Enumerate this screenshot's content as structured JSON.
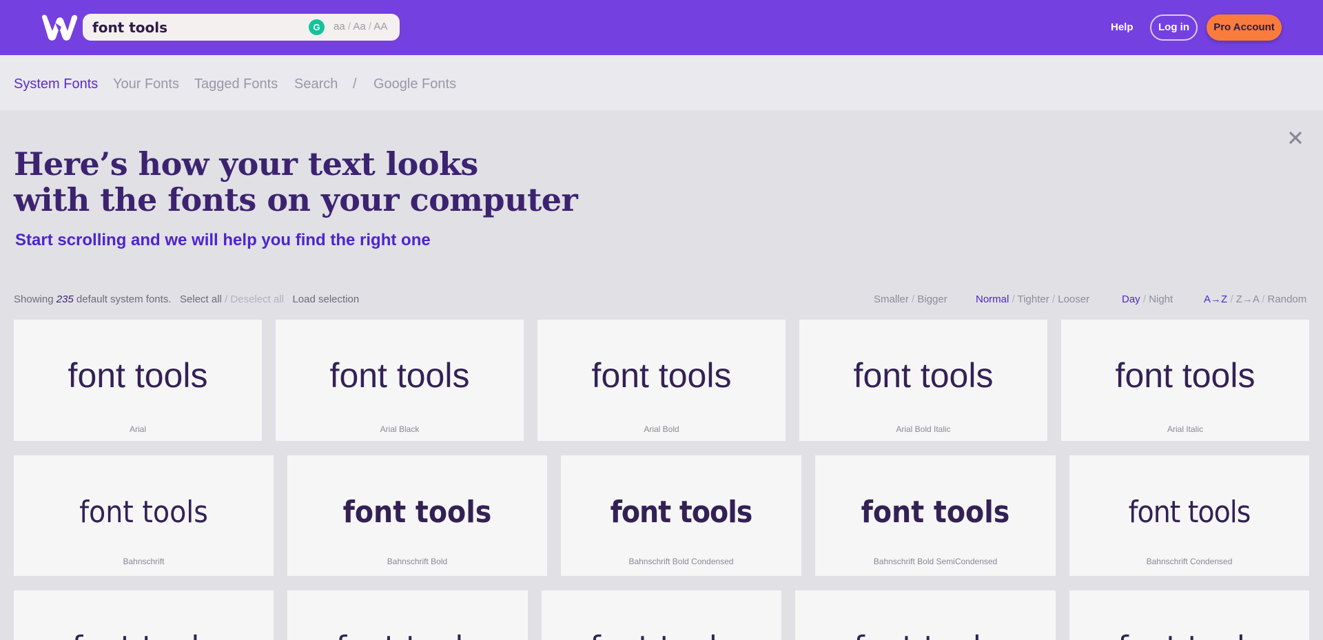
{
  "header": {
    "logo_icon": "fonts-w-logo-icon",
    "search_value": "font tools",
    "grammarly_icon": "grammarly-icon",
    "grammarly_glyph": "G",
    "case_options": [
      "aa",
      "Aa",
      "AA"
    ],
    "case_separator": "/",
    "help_label": "Help",
    "login_label": "Log in",
    "pro_label": "Pro Account"
  },
  "nav": {
    "system_fonts": "System Fonts",
    "your_fonts": "Your Fonts",
    "tagged_fonts": "Tagged Fonts",
    "search": "Search",
    "divider": "/",
    "google_fonts": "Google Fonts"
  },
  "hero": {
    "title_line1": "Here’s how your text looks",
    "title_line2": "with the fonts on your computer",
    "subtitle": "Start scrolling and we will help you find the right one",
    "close_icon": "close-icon"
  },
  "controls": {
    "showing_prefix": "Showing",
    "count": "235",
    "showing_suffix": "default system fonts.",
    "select_all": "Select all",
    "separator": "/",
    "deselect_all": "Deselect all",
    "load_selection": "Load selection",
    "size": {
      "smaller": "Smaller",
      "bigger": "Bigger"
    },
    "spacing": {
      "normal": "Normal",
      "tighter": "Tighter",
      "looser": "Looser",
      "selected": "Normal"
    },
    "theme": {
      "day": "Day",
      "night": "Night",
      "selected": "Day"
    },
    "sort": {
      "az": "A→Z",
      "za": "Z→A",
      "random": "Random",
      "selected": "A→Z"
    }
  },
  "sample_text": "font tools",
  "cards": {
    "row1": [
      {
        "name": "Arial"
      },
      {
        "name": "Arial Black"
      },
      {
        "name": "Arial Bold"
      },
      {
        "name": "Arial Bold Italic"
      },
      {
        "name": "Arial Italic"
      }
    ],
    "row2": [
      {
        "name": "Bahnschrift"
      },
      {
        "name": "Bahnschrift Bold"
      },
      {
        "name": "Bahnschrift Bold Condensed"
      },
      {
        "name": "Bahnschrift Bold SemiCondensed"
      },
      {
        "name": "Bahnschrift Condensed"
      }
    ]
  },
  "colors": {
    "header_bg": "#7540e0",
    "accent": "#4c24d0",
    "pro_button": "#f97c3c",
    "title": "#3c2370"
  }
}
